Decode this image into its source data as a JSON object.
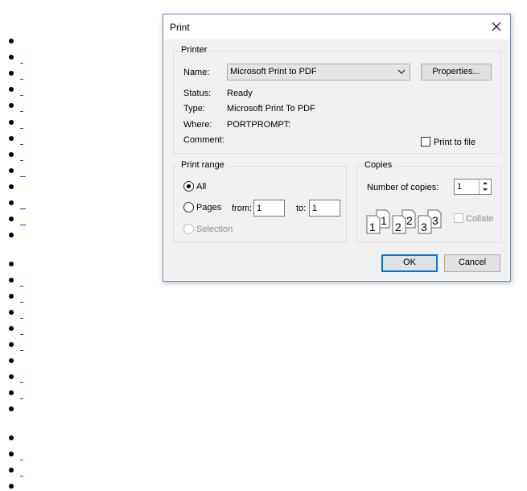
{
  "dialog": {
    "title": "Print",
    "printer": {
      "legend": "Printer",
      "name_label": "Name:",
      "name_value": "Microsoft Print to PDF",
      "properties_label": "Properties...",
      "status_label": "Status:",
      "status_value": "Ready",
      "type_label": "Type:",
      "type_value": "Microsoft Print To PDF",
      "where_label": "Where:",
      "where_value": "PORTPROMPT:",
      "comment_label": "Comment:",
      "print_to_file_label": "Print to file",
      "print_to_file_checked": false
    },
    "print_range": {
      "legend": "Print range",
      "all_label": "All",
      "pages_label": "Pages",
      "from_label": "from:",
      "from_value": "1",
      "to_label": "to:",
      "to_value": "1",
      "selection_label": "Selection",
      "selected": "All"
    },
    "copies": {
      "legend": "Copies",
      "number_label": "Number of copies:",
      "number_value": "1",
      "collate_label": "Collate",
      "collate_checked": false,
      "collate_pages": [
        "1",
        "1",
        "2",
        "2",
        "3",
        "3"
      ]
    },
    "ok_label": "OK",
    "cancel_label": "Cancel"
  },
  "colors": {
    "dialog_bg": "#f0f0f0",
    "title_bg": "#ffffff",
    "default_button_border": "#0078d7",
    "link_underline": "#0b47c1"
  },
  "icons": [
    "close-icon",
    "chevron-down-icon",
    "spin-up-icon",
    "spin-down-icon",
    "collate-pages-icon"
  ]
}
